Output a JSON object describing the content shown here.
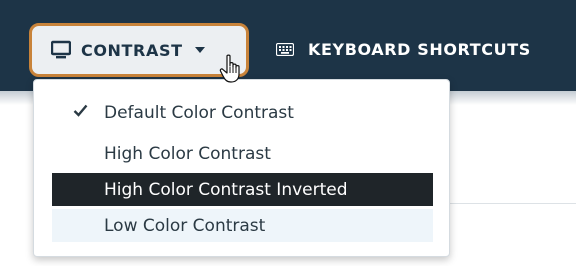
{
  "toolbar": {
    "contrast_label": "CONTRAST",
    "keyboard_shortcuts_label": "KEYBOARD SHORTCUTS"
  },
  "contrast_menu": {
    "items": [
      {
        "label": "Default Color Contrast",
        "checked": true
      },
      {
        "label": "High Color Contrast",
        "checked": false
      },
      {
        "label": "High Color Contrast Inverted",
        "checked": false,
        "style": "dark-highlight"
      },
      {
        "label": "Low Color Contrast",
        "checked": false,
        "style": "hovered"
      }
    ]
  },
  "icons": {
    "contrast_button": "monitor-icon",
    "dropdown_caret": "caret-down-icon",
    "keyboard_button": "keyboard-icon",
    "selected_marker": "checkmark-icon",
    "pointer": "hand-pointer-cursor"
  },
  "colors": {
    "toolbar_bg": "#1d3447",
    "button_focus_border": "#c8833a",
    "button_bg": "#eceff2",
    "inverted_item_bg": "#1f2529",
    "hover_item_bg": "#eef5fa"
  }
}
